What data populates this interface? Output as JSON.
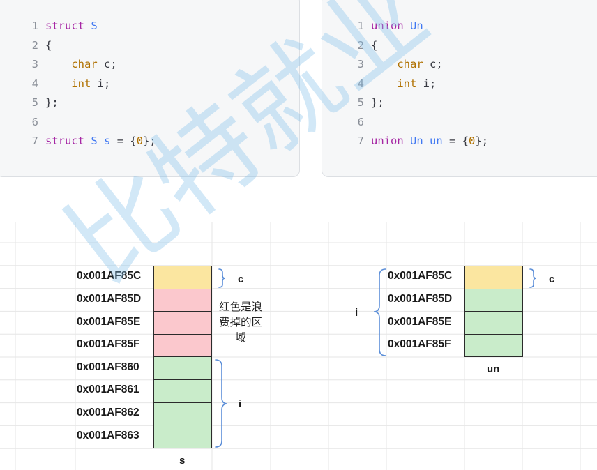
{
  "colors": {
    "padding_fill": "#fbc8cd",
    "char_fill": "#fbe6a0",
    "int_fill": "#c9ecca",
    "brace": "#5b8ed8"
  },
  "struct_code": {
    "lines": [
      {
        "n": "1",
        "tokens": [
          {
            "t": "struct",
            "c": "kw"
          },
          {
            "t": " ",
            "c": "pl"
          },
          {
            "t": "S",
            "c": "nm"
          }
        ]
      },
      {
        "n": "2",
        "tokens": [
          {
            "t": "{",
            "c": "pl"
          }
        ]
      },
      {
        "n": "3",
        "tokens": [
          {
            "t": "    ",
            "c": "pl"
          },
          {
            "t": "char",
            "c": "ty"
          },
          {
            "t": " c;",
            "c": "pl"
          }
        ]
      },
      {
        "n": "4",
        "tokens": [
          {
            "t": "    ",
            "c": "pl"
          },
          {
            "t": "int",
            "c": "ty"
          },
          {
            "t": " i;",
            "c": "pl"
          }
        ]
      },
      {
        "n": "5",
        "tokens": [
          {
            "t": "};",
            "c": "pl"
          }
        ]
      },
      {
        "n": "6",
        "tokens": []
      },
      {
        "n": "7",
        "tokens": [
          {
            "t": "struct",
            "c": "kw"
          },
          {
            "t": " ",
            "c": "pl"
          },
          {
            "t": "S",
            "c": "nm"
          },
          {
            "t": " ",
            "c": "pl"
          },
          {
            "t": "s",
            "c": "nm"
          },
          {
            "t": " = {",
            "c": "pl"
          },
          {
            "t": "0",
            "c": "num"
          },
          {
            "t": "};",
            "c": "pl"
          }
        ]
      }
    ]
  },
  "union_code": {
    "lines": [
      {
        "n": "1",
        "tokens": [
          {
            "t": "union",
            "c": "kw"
          },
          {
            "t": " ",
            "c": "pl"
          },
          {
            "t": "Un",
            "c": "nm"
          }
        ]
      },
      {
        "n": "2",
        "tokens": [
          {
            "t": "{",
            "c": "pl"
          }
        ]
      },
      {
        "n": "3",
        "tokens": [
          {
            "t": "    ",
            "c": "pl"
          },
          {
            "t": "char",
            "c": "ty"
          },
          {
            "t": " c;",
            "c": "pl"
          }
        ]
      },
      {
        "n": "4",
        "tokens": [
          {
            "t": "    ",
            "c": "pl"
          },
          {
            "t": "int",
            "c": "ty"
          },
          {
            "t": " i;",
            "c": "pl"
          }
        ]
      },
      {
        "n": "5",
        "tokens": [
          {
            "t": "};",
            "c": "pl"
          }
        ]
      },
      {
        "n": "6",
        "tokens": []
      },
      {
        "n": "7",
        "tokens": [
          {
            "t": "union",
            "c": "kw"
          },
          {
            "t": " ",
            "c": "pl"
          },
          {
            "t": "Un",
            "c": "nm"
          },
          {
            "t": " ",
            "c": "pl"
          },
          {
            "t": "un",
            "c": "nm"
          },
          {
            "t": " = {",
            "c": "pl"
          },
          {
            "t": "0",
            "c": "num"
          },
          {
            "t": "};",
            "c": "pl"
          }
        ]
      }
    ]
  },
  "struct_memory": {
    "addresses": [
      "0x001AF85C",
      "0x001AF85D",
      "0x001AF85E",
      "0x001AF85F",
      "0x001AF860",
      "0x001AF861",
      "0x001AF862",
      "0x001AF863"
    ],
    "cell_kinds": [
      "char",
      "pad",
      "pad",
      "pad",
      "int",
      "int",
      "int",
      "int"
    ],
    "label_c": "c",
    "label_i": "i",
    "note": "红色是浪费掉的区域",
    "caption": "s"
  },
  "union_memory": {
    "addresses": [
      "0x001AF85C",
      "0x001AF85D",
      "0x001AF85E",
      "0x001AF85F"
    ],
    "cell_kinds": [
      "char",
      "int",
      "int",
      "int"
    ],
    "label_c": "c",
    "label_i": "i",
    "caption": "un"
  },
  "watermark": "比特就业"
}
